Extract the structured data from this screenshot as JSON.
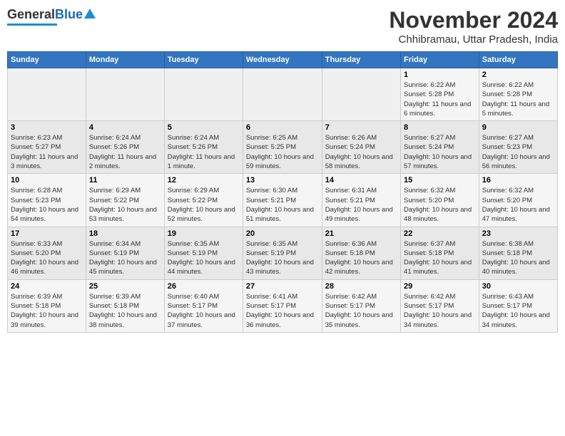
{
  "header": {
    "logo_general": "General",
    "logo_blue": "Blue",
    "title": "November 2024",
    "subtitle": "Chhibramau, Uttar Pradesh, India"
  },
  "days_of_week": [
    "Sunday",
    "Monday",
    "Tuesday",
    "Wednesday",
    "Thursday",
    "Friday",
    "Saturday"
  ],
  "weeks": [
    {
      "cells": [
        {
          "day": "",
          "info": ""
        },
        {
          "day": "",
          "info": ""
        },
        {
          "day": "",
          "info": ""
        },
        {
          "day": "",
          "info": ""
        },
        {
          "day": "",
          "info": ""
        },
        {
          "day": "1",
          "info": "Sunrise: 6:22 AM\nSunset: 5:28 PM\nDaylight: 11 hours and 6 minutes."
        },
        {
          "day": "2",
          "info": "Sunrise: 6:22 AM\nSunset: 5:28 PM\nDaylight: 11 hours and 5 minutes."
        }
      ]
    },
    {
      "cells": [
        {
          "day": "3",
          "info": "Sunrise: 6:23 AM\nSunset: 5:27 PM\nDaylight: 11 hours and 3 minutes."
        },
        {
          "day": "4",
          "info": "Sunrise: 6:24 AM\nSunset: 5:26 PM\nDaylight: 11 hours and 2 minutes."
        },
        {
          "day": "5",
          "info": "Sunrise: 6:24 AM\nSunset: 5:26 PM\nDaylight: 11 hours and 1 minute."
        },
        {
          "day": "6",
          "info": "Sunrise: 6:25 AM\nSunset: 5:25 PM\nDaylight: 10 hours and 59 minutes."
        },
        {
          "day": "7",
          "info": "Sunrise: 6:26 AM\nSunset: 5:24 PM\nDaylight: 10 hours and 58 minutes."
        },
        {
          "day": "8",
          "info": "Sunrise: 6:27 AM\nSunset: 5:24 PM\nDaylight: 10 hours and 57 minutes."
        },
        {
          "day": "9",
          "info": "Sunrise: 6:27 AM\nSunset: 5:23 PM\nDaylight: 10 hours and 56 minutes."
        }
      ]
    },
    {
      "cells": [
        {
          "day": "10",
          "info": "Sunrise: 6:28 AM\nSunset: 5:23 PM\nDaylight: 10 hours and 54 minutes."
        },
        {
          "day": "11",
          "info": "Sunrise: 6:29 AM\nSunset: 5:22 PM\nDaylight: 10 hours and 53 minutes."
        },
        {
          "day": "12",
          "info": "Sunrise: 6:29 AM\nSunset: 5:22 PM\nDaylight: 10 hours and 52 minutes."
        },
        {
          "day": "13",
          "info": "Sunrise: 6:30 AM\nSunset: 5:21 PM\nDaylight: 10 hours and 51 minutes."
        },
        {
          "day": "14",
          "info": "Sunrise: 6:31 AM\nSunset: 5:21 PM\nDaylight: 10 hours and 49 minutes."
        },
        {
          "day": "15",
          "info": "Sunrise: 6:32 AM\nSunset: 5:20 PM\nDaylight: 10 hours and 48 minutes."
        },
        {
          "day": "16",
          "info": "Sunrise: 6:32 AM\nSunset: 5:20 PM\nDaylight: 10 hours and 47 minutes."
        }
      ]
    },
    {
      "cells": [
        {
          "day": "17",
          "info": "Sunrise: 6:33 AM\nSunset: 5:20 PM\nDaylight: 10 hours and 46 minutes."
        },
        {
          "day": "18",
          "info": "Sunrise: 6:34 AM\nSunset: 5:19 PM\nDaylight: 10 hours and 45 minutes."
        },
        {
          "day": "19",
          "info": "Sunrise: 6:35 AM\nSunset: 5:19 PM\nDaylight: 10 hours and 44 minutes."
        },
        {
          "day": "20",
          "info": "Sunrise: 6:35 AM\nSunset: 5:19 PM\nDaylight: 10 hours and 43 minutes."
        },
        {
          "day": "21",
          "info": "Sunrise: 6:36 AM\nSunset: 5:18 PM\nDaylight: 10 hours and 42 minutes."
        },
        {
          "day": "22",
          "info": "Sunrise: 6:37 AM\nSunset: 5:18 PM\nDaylight: 10 hours and 41 minutes."
        },
        {
          "day": "23",
          "info": "Sunrise: 6:38 AM\nSunset: 5:18 PM\nDaylight: 10 hours and 40 minutes."
        }
      ]
    },
    {
      "cells": [
        {
          "day": "24",
          "info": "Sunrise: 6:39 AM\nSunset: 5:18 PM\nDaylight: 10 hours and 39 minutes."
        },
        {
          "day": "25",
          "info": "Sunrise: 6:39 AM\nSunset: 5:18 PM\nDaylight: 10 hours and 38 minutes."
        },
        {
          "day": "26",
          "info": "Sunrise: 6:40 AM\nSunset: 5:17 PM\nDaylight: 10 hours and 37 minutes."
        },
        {
          "day": "27",
          "info": "Sunrise: 6:41 AM\nSunset: 5:17 PM\nDaylight: 10 hours and 36 minutes."
        },
        {
          "day": "28",
          "info": "Sunrise: 6:42 AM\nSunset: 5:17 PM\nDaylight: 10 hours and 35 minutes."
        },
        {
          "day": "29",
          "info": "Sunrise: 6:42 AM\nSunset: 5:17 PM\nDaylight: 10 hours and 34 minutes."
        },
        {
          "day": "30",
          "info": "Sunrise: 6:43 AM\nSunset: 5:17 PM\nDaylight: 10 hours and 34 minutes."
        }
      ]
    }
  ]
}
